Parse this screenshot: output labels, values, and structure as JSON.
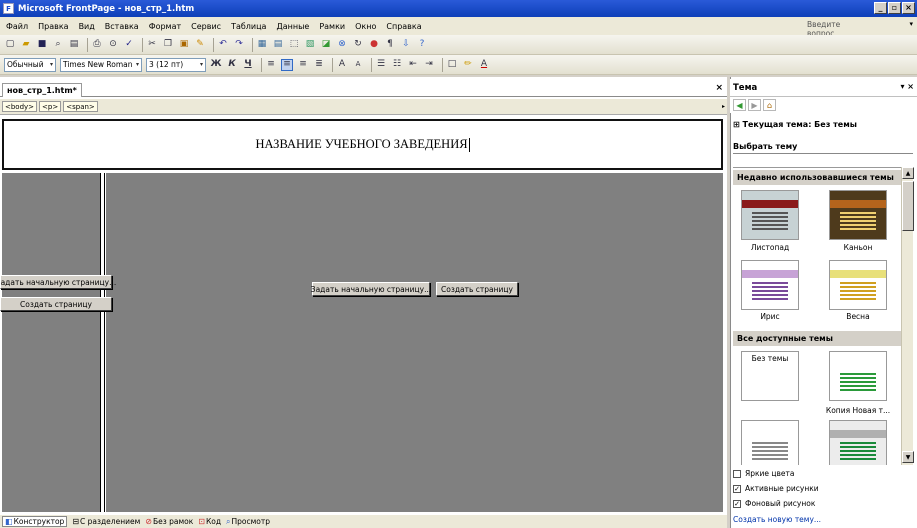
{
  "window": {
    "title": "Microsoft FrontPage - нов_стр_1.htm",
    "controls": [
      "_",
      "ф",
      "x"
    ]
  },
  "menu": {
    "items": [
      "Файл",
      "Правка",
      "Вид",
      "Вставка",
      "Формат",
      "Сервис",
      "Таблица",
      "Данные",
      "Рамки",
      "Окно",
      "Справка"
    ],
    "help_placeholder": "Введите вопрос"
  },
  "format_toolbar": {
    "style": "Обычный",
    "font": "Times New Roman",
    "size": "3 (12 пт)"
  },
  "document": {
    "tab_label": "нов_стр_1.htm*",
    "tags": [
      "<body>",
      "<p>",
      "<span>"
    ],
    "heading": "НАЗВАНИЕ УЧЕБНОГО ЗАВЕДЕНИЯ",
    "left_frame_buttons": [
      "Задать начальную страницу...",
      "Создать страницу"
    ],
    "main_frame_buttons": [
      "Задать начальную страницу...",
      "Создать страницу"
    ]
  },
  "views": [
    "Конструктор",
    "С разделением",
    "Без рамок",
    "Код",
    "Просмотр"
  ],
  "theme_pane": {
    "title": "Тема",
    "current_theme": "Текущая тема: Без темы",
    "choose_theme": "Выбрать тему",
    "recent_header": "Недавно использовавшиеся темы",
    "all_header": "Все доступные темы",
    "recent_themes": [
      {
        "name": "Листопад",
        "bg": "#c7d2d4",
        "top": "#8a1a1a",
        "line": "#555"
      },
      {
        "name": "Каньон",
        "bg": "#4e3a1c",
        "top": "#b5641c",
        "line": "#f0d070"
      },
      {
        "name": "Ирис",
        "bg": "#ffffff",
        "top": "#c7a3d6",
        "line": "#7a4a9a"
      },
      {
        "name": "Весна",
        "bg": "#ffffff",
        "top": "#e8e07a",
        "line": "#d0a020"
      }
    ],
    "all_themes": [
      {
        "name": "Без темы",
        "bg": "#ffffff",
        "top": "#ffffff",
        "line": "#ffffff"
      },
      {
        "name": "Копия Новая т...",
        "bg": "#ffffff",
        "top": "#ffffff",
        "line": "#2a9a3a"
      },
      {
        "name": "",
        "bg": "#ffffff",
        "top": "#ffffff",
        "line": "#888"
      },
      {
        "name": "",
        "bg": "#ececec",
        "top": "#b0b0b0",
        "line": "#1a8a3a"
      }
    ],
    "options": [
      {
        "label": "Яркие цвета",
        "checked": false
      },
      {
        "label": "Активные рисунки",
        "checked": true
      },
      {
        "label": "Фоновый рисунок",
        "checked": true
      }
    ],
    "create_link": "Создать новую тему..."
  }
}
